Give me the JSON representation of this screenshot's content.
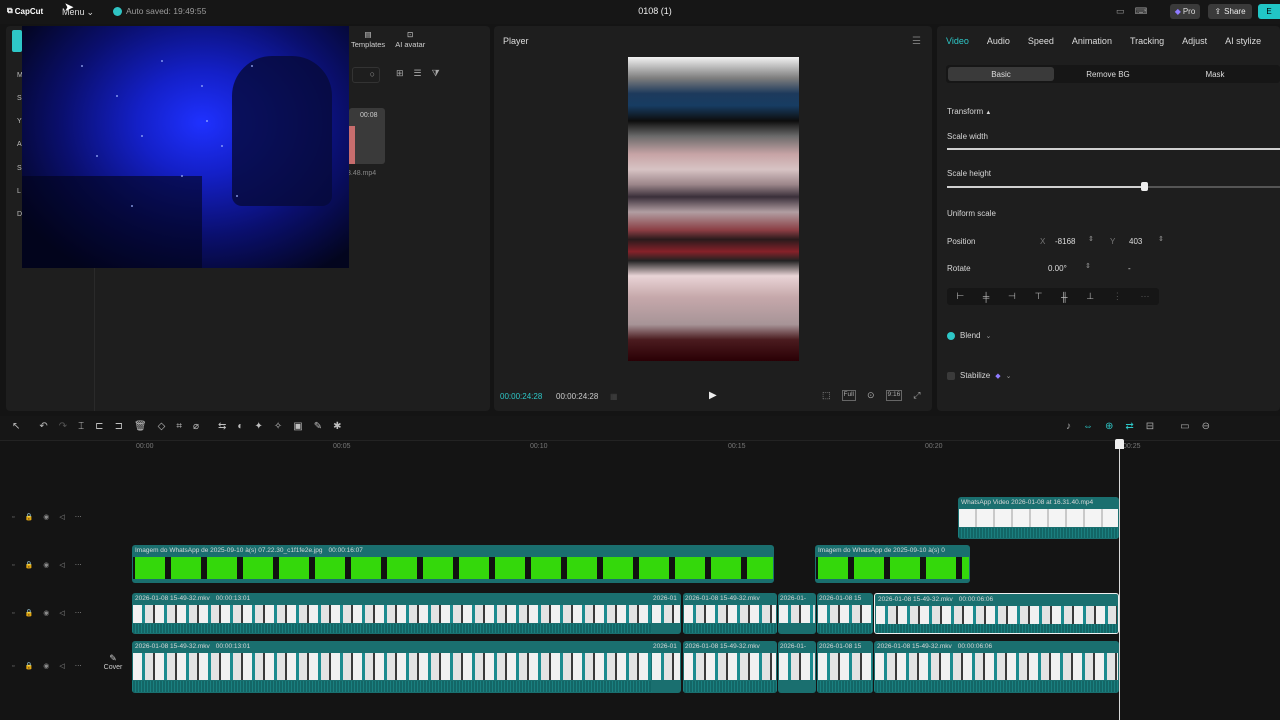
{
  "app": {
    "logo": "CapCut",
    "menu_label": "Menu",
    "autosave": "Auto saved: 19:49:55",
    "project_title": "0108 (1)",
    "pro_label": "Pro",
    "share_label": "Share",
    "export_label": "E"
  },
  "media_panel": {
    "tabs": [
      {
        "label": "Templates"
      },
      {
        "label": "AI avatar"
      }
    ],
    "sidebar_letters": [
      "M",
      "S",
      "Y",
      "A",
      "S",
      "L",
      "D"
    ],
    "thumbnail_duration": "00:08",
    "thumbnail_name": "3.48.mp4"
  },
  "player": {
    "title": "Player",
    "timecode_current": "00:00:24:28",
    "timecode_total": "00:00:24:28",
    "full_label": "Full",
    "ratio_label": "9:16"
  },
  "properties": {
    "tabs": [
      "Video",
      "Audio",
      "Speed",
      "Animation",
      "Tracking",
      "Adjust",
      "AI stylize"
    ],
    "active_tab": "Video",
    "segments": [
      "Basic",
      "Remove BG",
      "Mask"
    ],
    "active_segment": "Basic",
    "transform_label": "Transform",
    "scale_width_label": "Scale width",
    "scale_width_fraction": 1.0,
    "scale_height_label": "Scale height",
    "scale_height_fraction": 0.6,
    "uniform_scale_label": "Uniform scale",
    "position_label": "Position",
    "pos_x_label": "X",
    "pos_x": "-8168",
    "pos_y_label": "Y",
    "pos_y": "403",
    "rotate_label": "Rotate",
    "rotate_value": "0.00°",
    "rotate_extra": "-",
    "blend_label": "Blend",
    "stabilize_label": "Stabilize"
  },
  "timeline": {
    "ruler_labels": [
      "00:00",
      "00:05",
      "00:10",
      "00:15",
      "00:20",
      "00:25"
    ],
    "cover_label": "Cover",
    "clips": {
      "whatsapp_video": "WhatsApp Video 2026-01-08 at 16.31.40.mp4",
      "image_main": "Imagem do WhatsApp de 2025-09-10 à(s) 07.22.30_c1f1fe2e.jpg",
      "image_main_duration": "00:00:16:07",
      "image_second": "Imagem do WhatsApp de 2025-09-10 à(s) 0",
      "mkv_a": "2026-01-08 15-49-32.mkv",
      "mkv_a_duration": "00:00:13:01",
      "mkv_b": "2026-01",
      "mkv_c": "2026-01-08 15-49-32.mkv",
      "mkv_d": "2026-01-",
      "mkv_e": "2026-01-08 15",
      "mkv_selected": "2026-01-08 15-49-32.mkv",
      "mkv_selected_duration": "00:00:06:06"
    }
  }
}
